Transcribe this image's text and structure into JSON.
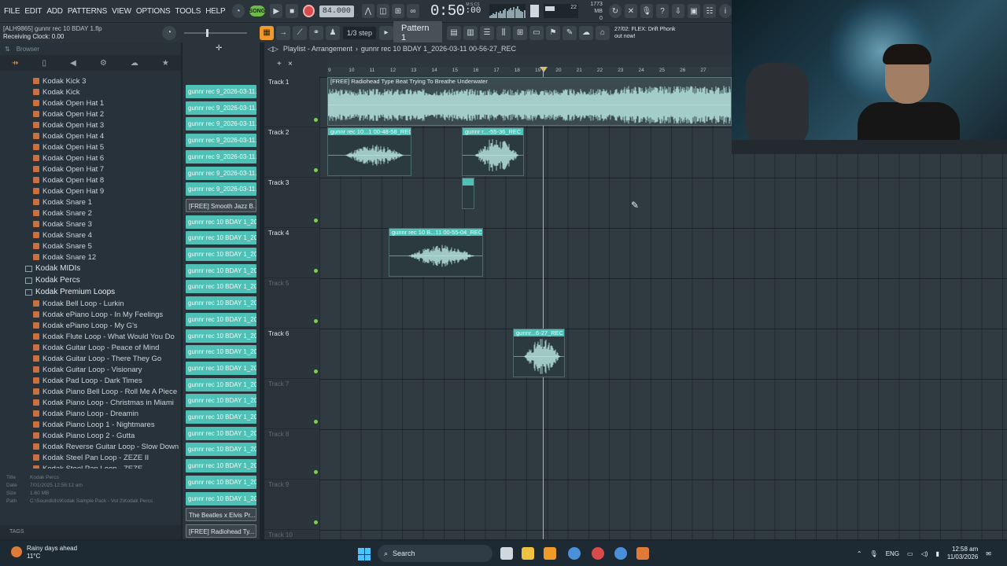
{
  "menu": [
    "FILE",
    "EDIT",
    "ADD",
    "PATTERNS",
    "VIEW",
    "OPTIONS",
    "TOOLS",
    "HELP"
  ],
  "transport": {
    "song_label": "SONG",
    "tempo": "84.000",
    "time": "0:50",
    "time_small": ":00",
    "time_mode": "M:S:CS"
  },
  "memory": {
    "line1": "1773 MB",
    "line2": "0",
    "cpu": "22"
  },
  "hint": {
    "line1": "[ALH9865] gunnr rec 10 BDAY 1.flp",
    "line2": "Receiving Clock: 0.00"
  },
  "toolbar": {
    "snap": "1/3 step",
    "pattern": "Pattern 1"
  },
  "news": {
    "line1": "27/02: FLEX: Drift Phonk",
    "line2": "out now!"
  },
  "browser": {
    "header": "Browser",
    "items": [
      "Kodak Kick 3",
      "Kodak Kick",
      "Kodak Open Hat 1",
      "Kodak Open Hat 2",
      "Kodak Open Hat 3",
      "Kodak Open Hat 4",
      "Kodak Open Hat 5",
      "Kodak Open Hat 6",
      "Kodak Open Hat 7",
      "Kodak Open Hat 8",
      "Kodak Open Hat 9",
      "Kodak Snare 1",
      "Kodak Snare 2",
      "Kodak Snare 3",
      "Kodak Snare 4",
      "Kodak Snare 5",
      "Kodak Snare 12"
    ],
    "folders": [
      "Kodak MIDIs",
      "Kodak Percs",
      "Kodak Premium Loops"
    ],
    "loops": [
      "Kodak Bell Loop - Lurkin",
      "Kodak ePiano Loop - In My Feelings",
      "Kodak ePiano Loop - My G's",
      "Kodak Flute Loop - What Would You Do",
      "Kodak Guitar Loop - Peace of Mind",
      "Kodak Guitar Loop - There They Go",
      "Kodak Guitar Loop - Visionary",
      "Kodak Pad Loop - Dark Times",
      "Kodak Piano Bell Loop - Roll Me A Piece",
      "Kodak Piano Loop - Christmas in Miami",
      "Kodak Piano Loop - Dreamin",
      "Kodak Piano Loop 1 - Nightmares",
      "Kodak Piano Loop 2 - Gutta",
      "Kodak Reverse Guitar Loop - Slow Down",
      "Kodak Steel Pan Loop - ZEZE II",
      "Kodak Steel Pan Loop - ZEZE"
    ],
    "info": {
      "title_label": "Title",
      "title": "Kodak Percs",
      "date_label": "Date",
      "date": "7/01/2025 12:56:12 am",
      "size_label": "Size",
      "size": "1.60 MB",
      "path_label": "Path",
      "path": "C:\\Soundkits\\Kodak Sample Pack - Vol 2\\Kodak Percs"
    },
    "tags_label": "TAGS"
  },
  "clip_list": [
    "gunnr rec 9_2026-03-11...",
    "gunnr rec 9_2026-03-11...",
    "gunnr rec 9_2026-03-11...",
    "gunnr rec 9_2026-03-11...",
    "gunnr rec 9_2026-03-11...",
    "gunnr rec 9_2026-03-11...",
    "gunnr rec 9_2026-03-11...",
    "[FREE] Smooth Jazz B...",
    "gunnr rec 10 BDAY 1_202...",
    "gunnr rec 10 BDAY 1_202...",
    "gunnr rec 10 BDAY 1_202...",
    "gunnr rec 10 BDAY 1_202...",
    "gunnr rec 10 BDAY 1_202...",
    "gunnr rec 10 BDAY 1_202...",
    "gunnr rec 10 BDAY 1_202...",
    "gunnr rec 10 BDAY 1_202...",
    "gunnr rec 10 BDAY 1_202...",
    "gunnr rec 10 BDAY 1_202...",
    "gunnr rec 10 BDAY 1_202...",
    "gunnr rec 10 BDAY 1_202...",
    "gunnr rec 10 BDAY 1_202...",
    "gunnr rec 10 BDAY 1_202...",
    "gunnr rec 10 BDAY 1_202...",
    "gunnr rec 10 BDAY 1_202...",
    "gunnr rec 10 BDAY 1_202...",
    "gunnr rec 10 BDAY 1_202...",
    "The Beatles x Elvis Pr...",
    "[FREE] Radiohead Ty..."
  ],
  "playlist": {
    "title": "Playlist - Arrangement",
    "crumb": "gunnr rec 10 BDAY 1_2026-03-11 00-56-27_REC",
    "ruler": [
      "9",
      "10",
      "11",
      "12",
      "13",
      "14",
      "15",
      "16",
      "17",
      "18",
      "19",
      "20",
      "21",
      "22",
      "23",
      "24",
      "25",
      "26",
      "27"
    ],
    "tracks": [
      "Track 1",
      "Track 2",
      "Track 3",
      "Track 4",
      "Track 5",
      "Track 6",
      "Track 7",
      "Track 8",
      "Track 9",
      "Track 10"
    ],
    "clips": {
      "t1": "[FREE] Radiohead Type Beat  Trying To Breathe Underwater",
      "t2a": "gunnr rec 10...1 00-48-58_REC",
      "t2b": "gunnr r...-55-36_REC",
      "t4": "gunnr rec 10 B...11 00-55-04_REC",
      "t6": "gunnr...6-27_REC"
    }
  },
  "taskbar": {
    "weather_title": "Rainy days ahead",
    "weather_temp": "11°C",
    "search": "Search",
    "lang": "ENG",
    "time": "12:58 am",
    "date": "11/03/2026"
  },
  "colors": {
    "accent": "#4fc0b5",
    "record": "#d94a4a",
    "folder_icon": "#c8703e"
  }
}
